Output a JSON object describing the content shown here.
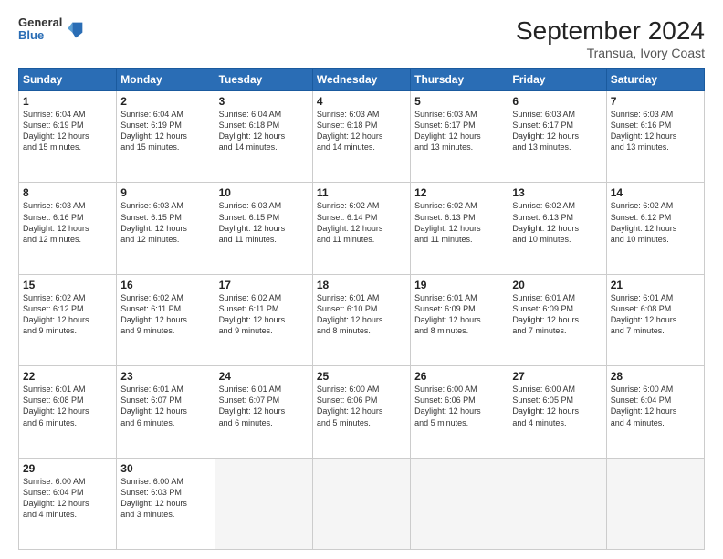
{
  "logo": {
    "general": "General",
    "blue": "Blue"
  },
  "title": "September 2024",
  "subtitle": "Transua, Ivory Coast",
  "headers": [
    "Sunday",
    "Monday",
    "Tuesday",
    "Wednesday",
    "Thursday",
    "Friday",
    "Saturday"
  ],
  "weeks": [
    [
      {
        "day": "1",
        "sunrise": "6:04 AM",
        "sunset": "6:19 PM",
        "daylight": "12 hours and 15 minutes."
      },
      {
        "day": "2",
        "sunrise": "6:04 AM",
        "sunset": "6:19 PM",
        "daylight": "12 hours and 15 minutes."
      },
      {
        "day": "3",
        "sunrise": "6:04 AM",
        "sunset": "6:18 PM",
        "daylight": "12 hours and 14 minutes."
      },
      {
        "day": "4",
        "sunrise": "6:03 AM",
        "sunset": "6:18 PM",
        "daylight": "12 hours and 14 minutes."
      },
      {
        "day": "5",
        "sunrise": "6:03 AM",
        "sunset": "6:17 PM",
        "daylight": "12 hours and 13 minutes."
      },
      {
        "day": "6",
        "sunrise": "6:03 AM",
        "sunset": "6:17 PM",
        "daylight": "12 hours and 13 minutes."
      },
      {
        "day": "7",
        "sunrise": "6:03 AM",
        "sunset": "6:16 PM",
        "daylight": "12 hours and 13 minutes."
      }
    ],
    [
      {
        "day": "8",
        "sunrise": "6:03 AM",
        "sunset": "6:16 PM",
        "daylight": "12 hours and 12 minutes."
      },
      {
        "day": "9",
        "sunrise": "6:03 AM",
        "sunset": "6:15 PM",
        "daylight": "12 hours and 12 minutes."
      },
      {
        "day": "10",
        "sunrise": "6:03 AM",
        "sunset": "6:15 PM",
        "daylight": "12 hours and 11 minutes."
      },
      {
        "day": "11",
        "sunrise": "6:02 AM",
        "sunset": "6:14 PM",
        "daylight": "12 hours and 11 minutes."
      },
      {
        "day": "12",
        "sunrise": "6:02 AM",
        "sunset": "6:13 PM",
        "daylight": "12 hours and 11 minutes."
      },
      {
        "day": "13",
        "sunrise": "6:02 AM",
        "sunset": "6:13 PM",
        "daylight": "12 hours and 10 minutes."
      },
      {
        "day": "14",
        "sunrise": "6:02 AM",
        "sunset": "6:12 PM",
        "daylight": "12 hours and 10 minutes."
      }
    ],
    [
      {
        "day": "15",
        "sunrise": "6:02 AM",
        "sunset": "6:12 PM",
        "daylight": "12 hours and 9 minutes."
      },
      {
        "day": "16",
        "sunrise": "6:02 AM",
        "sunset": "6:11 PM",
        "daylight": "12 hours and 9 minutes."
      },
      {
        "day": "17",
        "sunrise": "6:02 AM",
        "sunset": "6:11 PM",
        "daylight": "12 hours and 9 minutes."
      },
      {
        "day": "18",
        "sunrise": "6:01 AM",
        "sunset": "6:10 PM",
        "daylight": "12 hours and 8 minutes."
      },
      {
        "day": "19",
        "sunrise": "6:01 AM",
        "sunset": "6:09 PM",
        "daylight": "12 hours and 8 minutes."
      },
      {
        "day": "20",
        "sunrise": "6:01 AM",
        "sunset": "6:09 PM",
        "daylight": "12 hours and 7 minutes."
      },
      {
        "day": "21",
        "sunrise": "6:01 AM",
        "sunset": "6:08 PM",
        "daylight": "12 hours and 7 minutes."
      }
    ],
    [
      {
        "day": "22",
        "sunrise": "6:01 AM",
        "sunset": "6:08 PM",
        "daylight": "12 hours and 6 minutes."
      },
      {
        "day": "23",
        "sunrise": "6:01 AM",
        "sunset": "6:07 PM",
        "daylight": "12 hours and 6 minutes."
      },
      {
        "day": "24",
        "sunrise": "6:01 AM",
        "sunset": "6:07 PM",
        "daylight": "12 hours and 6 minutes."
      },
      {
        "day": "25",
        "sunrise": "6:00 AM",
        "sunset": "6:06 PM",
        "daylight": "12 hours and 5 minutes."
      },
      {
        "day": "26",
        "sunrise": "6:00 AM",
        "sunset": "6:06 PM",
        "daylight": "12 hours and 5 minutes."
      },
      {
        "day": "27",
        "sunrise": "6:00 AM",
        "sunset": "6:05 PM",
        "daylight": "12 hours and 4 minutes."
      },
      {
        "day": "28",
        "sunrise": "6:00 AM",
        "sunset": "6:04 PM",
        "daylight": "12 hours and 4 minutes."
      }
    ],
    [
      {
        "day": "29",
        "sunrise": "6:00 AM",
        "sunset": "6:04 PM",
        "daylight": "12 hours and 4 minutes."
      },
      {
        "day": "30",
        "sunrise": "6:00 AM",
        "sunset": "6:03 PM",
        "daylight": "12 hours and 3 minutes."
      },
      null,
      null,
      null,
      null,
      null
    ]
  ]
}
